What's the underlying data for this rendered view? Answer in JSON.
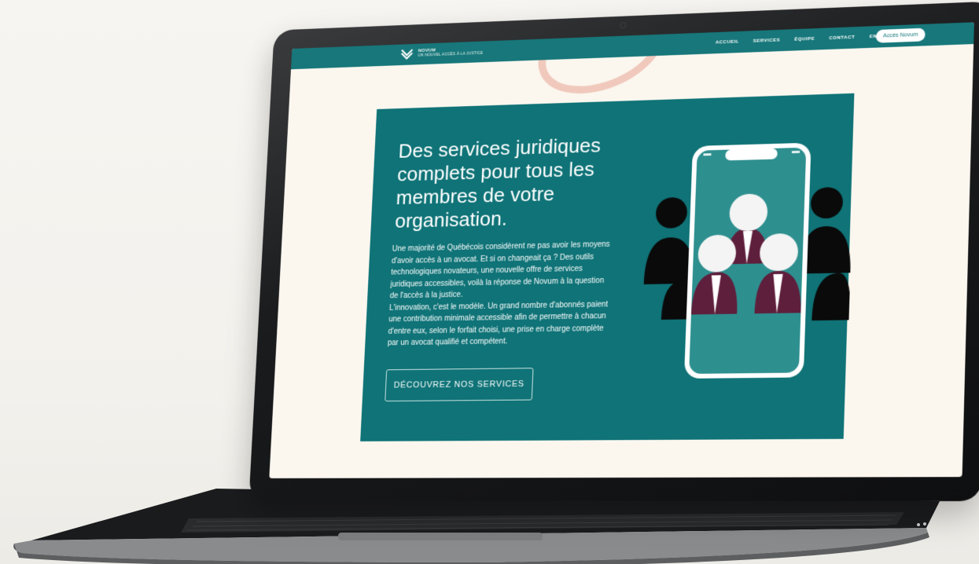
{
  "site": {
    "brand_name": "NOVUM",
    "brand_tagline": "UN NOUVEL ACCÈS À LA JUSTICE",
    "nav": {
      "items": [
        "ACCUEIL",
        "SERVICES",
        "ÉQUIPE",
        "CONTACT",
        "EN"
      ],
      "cta_label": "Accès Novum"
    },
    "hero": {
      "title": "Des services juridiques complets pour tous les membres de votre organisation.",
      "paragraph_1": "Une majorité de Québécois considèrent ne pas avoir les moyens d'avoir accès à un avocat. Et si on changeait ça ? Des outils technologiques novateurs, une nouvelle offre de services juridiques accessibles, voilà la réponse de Novum à la question de l'accès à la justice.",
      "paragraph_2": "L'innovation, c'est le modèle. Un grand nombre d'abonnés paient une contribution minimale accessible afin de permettre à chacun d'entre eux, selon le forfait choisi, une prise en charge complète par un avocat qualifié et compétent.",
      "button_label": "DÉCOUVREZ NOS SERVICES"
    }
  },
  "colors": {
    "teal": "#0f7377",
    "nav_teal": "#17777a",
    "plum": "#5e1f3c",
    "cream": "#fbf7ef",
    "peach_arc": "#f0c9bc"
  },
  "icons": [
    "novum-logo-icon",
    "smartphone-icon",
    "lawyer-icon",
    "people-silhouette-icon"
  ]
}
